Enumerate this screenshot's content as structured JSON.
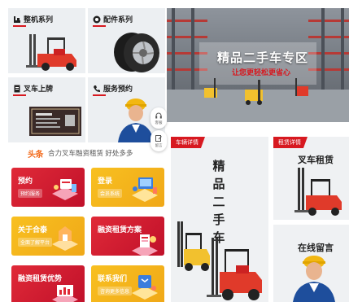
{
  "categories": {
    "machines": {
      "label": "整机系列",
      "icon": "forklift-logo-icon"
    },
    "parts": {
      "label": "配件系列",
      "icon": "gear-circle-icon"
    },
    "listing": {
      "label": "叉车上牌",
      "icon": "document-icon"
    },
    "service": {
      "label": "服务预约",
      "icon": "phone-icon"
    }
  },
  "headline": {
    "logo": "头条",
    "text": "合力叉车融资租赁 好处多多"
  },
  "cards": {
    "reserve": {
      "title": "预约",
      "sub": "预约服务"
    },
    "login": {
      "title": "登录",
      "sub": "会员系统"
    },
    "about": {
      "title": "关于合泰",
      "sub": "全面了解平台"
    },
    "finance_plan": {
      "title": "融资租赁方案",
      "sub": ""
    },
    "finance_adv": {
      "title": "融资租赁优势",
      "sub": ""
    },
    "contact": {
      "title": "联系我们",
      "sub": "咨询更多信息"
    }
  },
  "banner": {
    "title": "精品二手车专区",
    "subtitle": "让您更轻松更省心"
  },
  "floats": {
    "service": "客服",
    "message": "留言"
  },
  "panels": {
    "vehicle": {
      "tag": "车辆详情",
      "text": "精品二手车"
    },
    "rent": {
      "tag": "租赁详情",
      "title": "叉车租赁"
    },
    "message": {
      "title": "在线留言"
    }
  },
  "colors": {
    "brand_red": "#d71920",
    "card_red": "#e02a38",
    "card_yellow": "#f8c020",
    "forklift_red": "#e03a2a",
    "forklift_yellow": "#f2c12e"
  }
}
